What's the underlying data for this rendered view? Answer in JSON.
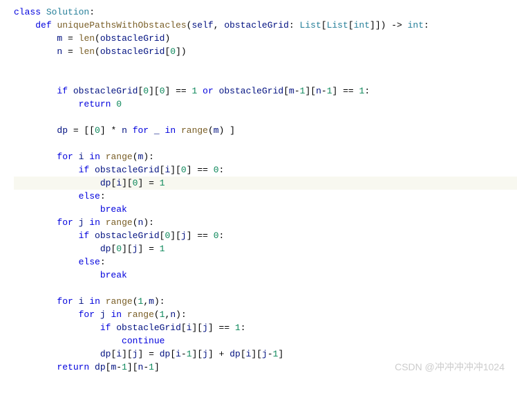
{
  "code": {
    "keywords": {
      "class": "class",
      "def": "def",
      "if": "if",
      "or": "or",
      "return": "return",
      "for": "for",
      "in": "in",
      "else": "else",
      "break": "break",
      "continue": "continue"
    },
    "identifiers": {
      "Solution": "Solution",
      "uniquePathsWithObstacles": "uniquePathsWithObstacles",
      "self": "self",
      "obstacleGrid": "obstacleGrid",
      "List": "List",
      "int": "int",
      "m": "m",
      "n": "n",
      "len": "len",
      "dp": "dp",
      "range": "range",
      "i": "i",
      "j": "j",
      "underscore": "_"
    },
    "numbers": {
      "zero": "0",
      "one": "1"
    },
    "lines": {
      "l1": "class Solution:",
      "l2": "def uniquePathsWithObstacles(self, obstacleGrid: List[List[int]]) -> int:",
      "l3": "m = len(obstacleGrid)",
      "l4": "n = len(obstacleGrid[0])",
      "l5": "if obstacleGrid[0][0] == 1 or obstacleGrid[m-1][n-1] == 1:",
      "l6": "return 0",
      "l7": "dp = [[0] * n for _ in range(m) ]",
      "l8": "for i in range(m):",
      "l9": "if obstacleGrid[i][0] == 0:",
      "l10": "dp[i][0] = 1",
      "l11": "else:",
      "l12": "break",
      "l13": "for j in range(n):",
      "l14": "if obstacleGrid[0][j] == 0:",
      "l15": "dp[0][j] = 1",
      "l16": "else:",
      "l17": "break",
      "l18": "for i in range(1,m):",
      "l19": "for j in range(1,n):",
      "l20": "if obstacleGrid[i][j] == 1:",
      "l21": "continue",
      "l22": "dp[i][j] = dp[i-1][j] + dp[i][j-1]",
      "l23": "return dp[m-1][n-1]"
    }
  },
  "watermark": "CSDN @冲冲冲冲冲1024"
}
